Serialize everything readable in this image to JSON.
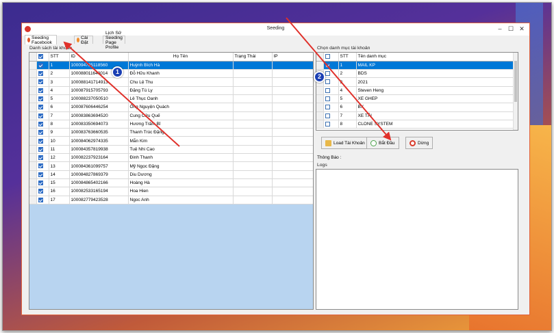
{
  "window": {
    "title": "Seeding"
  },
  "tabs": [
    {
      "label": "Seeding Facebook"
    },
    {
      "label": "Cài Đặt"
    },
    {
      "label": "Lịch Sử Seeding Page Profile"
    }
  ],
  "left_group": {
    "label": "Danh sách tài khoản",
    "columns": [
      "STT",
      "ID",
      "Họ Tên",
      "Trạng Thái",
      "IP"
    ],
    "rows": [
      {
        "stt": "1",
        "id": "100094735118560",
        "name": "Huỳnh Bích Hà",
        "selected": true
      },
      {
        "stt": "2",
        "id": "100088011640014",
        "name": "Đỗ Hữu Khanh",
        "selected": false
      },
      {
        "stt": "3",
        "id": "100088141714913",
        "name": "Chu Lệ Thu",
        "selected": false
      },
      {
        "stt": "4",
        "id": "100087915705793",
        "name": "Đặng Tú Ly",
        "selected": false
      },
      {
        "stt": "5",
        "id": "100088237050510",
        "name": "Lê Thục Oanh",
        "selected": false
      },
      {
        "stt": "6",
        "id": "100087606446254",
        "name": "Ông Nguyện Quách",
        "selected": false
      },
      {
        "stt": "7",
        "id": "100083863694520",
        "name": "Cung Cửu Quế",
        "selected": false
      },
      {
        "stt": "8",
        "id": "100083350694073",
        "name": "Hương Trâm Bỉ",
        "selected": false
      },
      {
        "stt": "9",
        "id": "100083763660535",
        "name": "Thanh Trúc Đặng",
        "selected": false
      },
      {
        "stt": "10",
        "id": "100084062974335",
        "name": "Mẫn Kim",
        "selected": false
      },
      {
        "stt": "11",
        "id": "100084357819938",
        "name": "Tuệ Nhi Cao",
        "selected": false
      },
      {
        "stt": "12",
        "id": "100082237923164",
        "name": "Đinh Thanh",
        "selected": false
      },
      {
        "stt": "13",
        "id": "100084361099757",
        "name": "Mỹ Ngọc Đặng",
        "selected": false
      },
      {
        "stt": "14",
        "id": "100084827869379",
        "name": "Diu Dương",
        "selected": false
      },
      {
        "stt": "15",
        "id": "100084865402166",
        "name": "Hoàng Hà",
        "selected": false
      },
      {
        "stt": "16",
        "id": "100082533165194",
        "name": "Hoa Hien",
        "selected": false
      },
      {
        "stt": "17",
        "id": "100082779423528",
        "name": "Ngoc Anh",
        "selected": false
      }
    ]
  },
  "right_group": {
    "label": "Chọn danh mục tài khoản",
    "columns": [
      "STT",
      "Tên danh mục"
    ],
    "rows": [
      {
        "stt": "1",
        "name": "MAIL KP",
        "selected": true
      },
      {
        "stt": "2",
        "name": "BDS",
        "selected": false
      },
      {
        "stt": "3",
        "name": "2021",
        "selected": false
      },
      {
        "stt": "4",
        "name": "Steven Heng",
        "selected": false
      },
      {
        "stt": "5",
        "name": "XE GHEP",
        "selected": false
      },
      {
        "stt": "6",
        "name": "BX",
        "selected": false
      },
      {
        "stt": "7",
        "name": "XE TẢI",
        "selected": false
      },
      {
        "stt": "8",
        "name": "CLONE SYSTEM",
        "selected": false
      }
    ]
  },
  "buttons": {
    "load": "Load Tài Khoản",
    "start": "Bắt Đầu",
    "stop": "Dừng"
  },
  "status": {
    "label": "Thông Báo :"
  },
  "logs": {
    "label": "Logs"
  },
  "annotations": {
    "badge1": "1",
    "badge2": "2"
  },
  "colors": {
    "selection": "#0078d7",
    "arrow": "#e0302a",
    "badge": "#1b3fb3"
  }
}
